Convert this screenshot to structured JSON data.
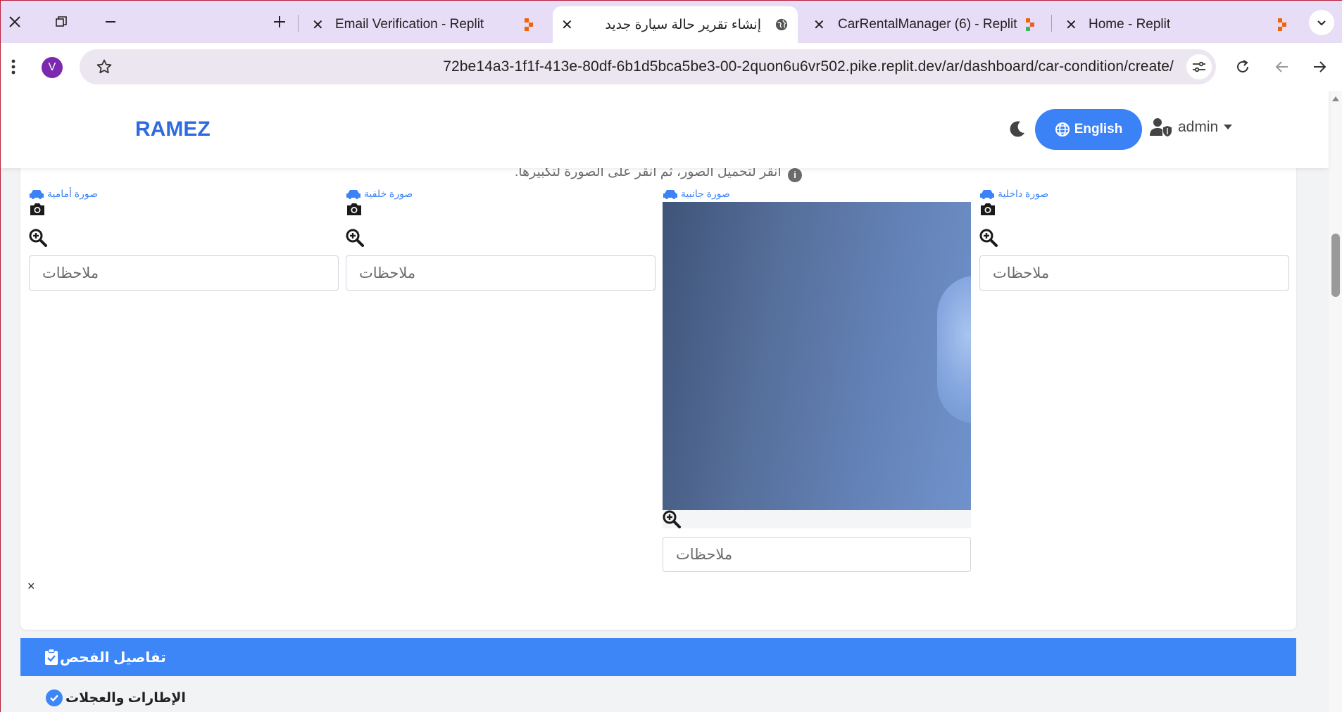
{
  "browser": {
    "tabs": [
      {
        "title": "Email Verification - Replit"
      },
      {
        "title": "إنشاء تقرير حالة سيارة جديد"
      },
      {
        "title": "CarRentalManager (6) - Replit"
      },
      {
        "title": "Home - Replit"
      }
    ],
    "profile_initial": "V",
    "url": "72be14a3-1f1f-413e-80df-6b1d5bca5be3-00-2quon6u6vr502.pike.replit.dev/ar/dashboard/car-condition/create/"
  },
  "navbar": {
    "brand": "RAMEZ",
    "language_button": "English",
    "user_name": "admin"
  },
  "photos": {
    "hint": "انقر لتحميل الصور، ثم انقر على الصورة لتكبيرها.",
    "columns": [
      {
        "label": "صورة أمامية",
        "notes_placeholder": "ملاحظات"
      },
      {
        "label": "صورة خلفية",
        "notes_placeholder": "ملاحظات"
      },
      {
        "label": "صورة جانبية",
        "notes_placeholder": "ملاحظات"
      },
      {
        "label": "صورة داخلية",
        "notes_placeholder": "ملاحظات"
      }
    ],
    "close_symbol": "×"
  },
  "inspection": {
    "title": "تفاصيل الفحص",
    "tires_label": "الإطارات والعجلات"
  },
  "colors": {
    "accent": "#3b82f6",
    "section_header": "#3d86f8",
    "brand": "#2f6be0",
    "tabbar": "#e8ddf6"
  }
}
